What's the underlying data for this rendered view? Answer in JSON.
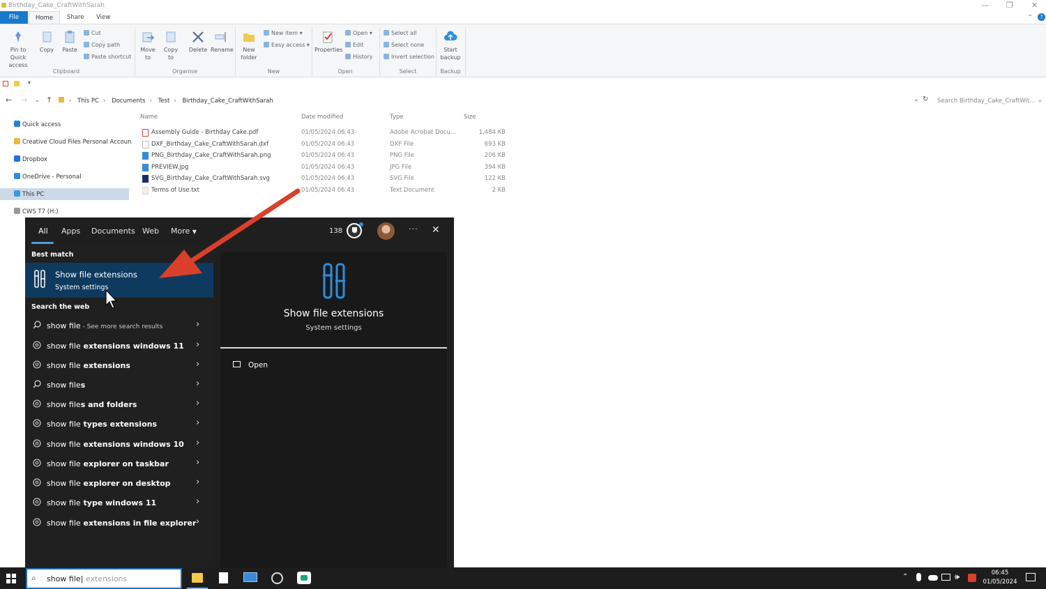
{
  "window": {
    "title": "Birthday_Cake_CraftWithSarah"
  },
  "tabs": [
    "File",
    "Home",
    "Share",
    "View"
  ],
  "ribbon": {
    "clipboard": {
      "pin": "Pin to Quick access",
      "copy": "Copy",
      "paste": "Paste",
      "cut": "Cut",
      "copy_path": "Copy path",
      "paste_shortcut": "Paste shortcut",
      "group": "Clipboard"
    },
    "organise": {
      "move_to": "Move to",
      "copy_to": "Copy to",
      "delete": "Delete",
      "rename": "Rename",
      "group": "Organise"
    },
    "new": {
      "new_folder": "New folder",
      "new_item": "New item",
      "easy_access": "Easy access",
      "group": "New"
    },
    "open": {
      "properties": "Properties",
      "open": "Open",
      "edit": "Edit",
      "history": "History",
      "group": "Open"
    },
    "select": {
      "select_all": "Select all",
      "select_none": "Select none",
      "invert": "Invert selection",
      "group": "Select"
    },
    "backup": {
      "start": "Start backup",
      "group": "Backup"
    }
  },
  "address": {
    "crumbs": [
      "This PC",
      "Documents",
      "Test",
      "Birthday_Cake_CraftWithSarah"
    ],
    "search_placeholder": "Search Birthday_Cake_CraftWit..."
  },
  "nav": [
    {
      "label": "Quick access",
      "color": "#2a7fd4"
    },
    {
      "label": "Creative Cloud Files Personal Accoun",
      "color": "#e6b93a"
    },
    {
      "label": "Dropbox",
      "color": "#1f6fe0"
    },
    {
      "label": "OneDrive - Personal",
      "color": "#2a8fe0"
    },
    {
      "label": "This PC",
      "color": "#3a9ad9"
    },
    {
      "label": "CWS T7 (H:)",
      "color": "#999999"
    }
  ],
  "files": {
    "headers": {
      "name": "Name",
      "date": "Date modified",
      "type": "Type",
      "size": "Size"
    },
    "rows": [
      {
        "name": "Assembly Guide - Birthday Cake.pdf",
        "date": "01/05/2024 06:43",
        "type": "Adobe Acrobat Docu...",
        "size": "1,484 KB",
        "icon": "#d94040"
      },
      {
        "name": "DXF_Birthday_Cake_CraftWithSarah.dxf",
        "date": "01/05/2024 06:43",
        "type": "DXF File",
        "size": "693 KB",
        "icon": "#ffffff"
      },
      {
        "name": "PNG_Birthday_Cake_CraftWithSarah.png",
        "date": "01/05/2024 06:43",
        "type": "PNG File",
        "size": "206 KB",
        "icon": "#3a8ad9"
      },
      {
        "name": "PREVIEW.jpg",
        "date": "01/05/2024 06:43",
        "type": "JPG File",
        "size": "394 KB",
        "icon": "#3a8ad9"
      },
      {
        "name": "SVG_Birthday_Cake_CraftWithSarah.svg",
        "date": "01/05/2024 06:43",
        "type": "SVG File",
        "size": "122 KB",
        "icon": "#1a2a6a"
      },
      {
        "name": "Terms of Use.txt",
        "date": "01/05/2024 06:43",
        "type": "Text Document",
        "size": "2 KB",
        "icon": "#eeeeee"
      }
    ]
  },
  "search_panel": {
    "tabs": [
      "All",
      "Apps",
      "Documents",
      "Web",
      "More"
    ],
    "points": "138",
    "best_match_label": "Best match",
    "best": {
      "title": "Show file extensions",
      "subtitle": "System settings"
    },
    "web_label": "Search the web",
    "suggestions": [
      {
        "pre": "show file",
        "bold": "",
        "sub": " - See more search results",
        "kind": "search"
      },
      {
        "pre": "show file",
        "bold": " extensions windows 11",
        "sub": "",
        "kind": "web"
      },
      {
        "pre": "show file",
        "bold": " extensions",
        "sub": "",
        "kind": "web"
      },
      {
        "pre": "show file",
        "bold": "s",
        "sub": "",
        "kind": "search"
      },
      {
        "pre": "show file",
        "bold": "s and folders",
        "sub": "",
        "kind": "web"
      },
      {
        "pre": "show file",
        "bold": " types extensions",
        "sub": "",
        "kind": "web"
      },
      {
        "pre": "show file",
        "bold": " extensions windows 10",
        "sub": "",
        "kind": "web"
      },
      {
        "pre": "show file",
        "bold": " explorer on taskbar",
        "sub": "",
        "kind": "web"
      },
      {
        "pre": "show file",
        "bold": " explorer on desktop",
        "sub": "",
        "kind": "web"
      },
      {
        "pre": "show file",
        "bold": " type windows 11",
        "sub": "",
        "kind": "web"
      },
      {
        "pre": "show file",
        "bold": " extensions in file explorer",
        "sub": "",
        "kind": "web"
      }
    ],
    "detail": {
      "title": "Show file extensions",
      "subtitle": "System settings",
      "action": "Open"
    }
  },
  "taskbar": {
    "search_typed": "show file",
    "search_ghost": " extensions",
    "time": "06:45",
    "date": "01/05/2024"
  },
  "colors": {
    "accent": "#1979ca",
    "selection": "#0f3a5f",
    "arrow": "#d9402b"
  }
}
